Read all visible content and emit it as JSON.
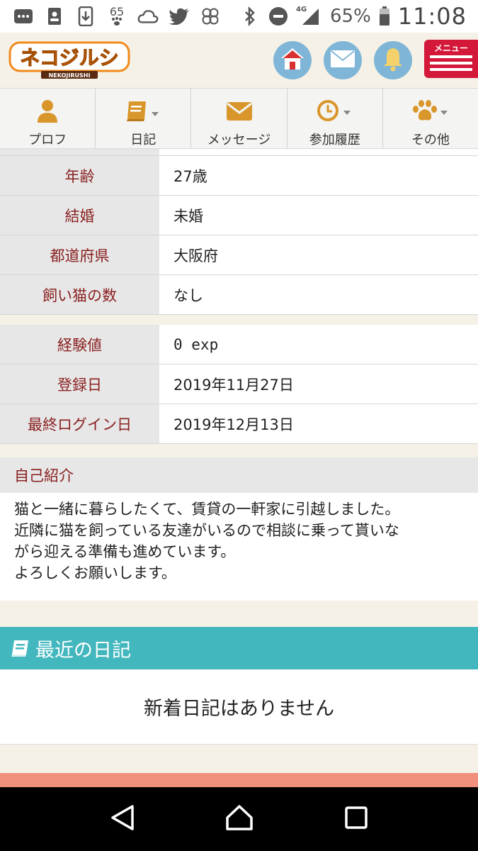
{
  "statusbar": {
    "notif_count": "65",
    "network": "4G",
    "battery": "65%",
    "time": "11:08"
  },
  "header": {
    "logo_text": "ネコジルシ",
    "logo_sub": "NEKOJIRUSHI",
    "menu_label": "メニュー"
  },
  "nav": [
    {
      "label": "プロフ",
      "icon": "person-icon"
    },
    {
      "label": "日記",
      "icon": "book-icon"
    },
    {
      "label": "メッセージ",
      "icon": "envelope-icon"
    },
    {
      "label": "参加履歴",
      "icon": "clock-icon"
    },
    {
      "label": "その他",
      "icon": "paw-icon"
    }
  ],
  "profile_group1": [
    {
      "key": "年齢",
      "value": "27歳"
    },
    {
      "key": "結婚",
      "value": "未婚"
    },
    {
      "key": "都道府県",
      "value": "大阪府"
    },
    {
      "key": "飼い猫の数",
      "value": "なし"
    }
  ],
  "profile_group2": [
    {
      "key": "経験値",
      "value": "0 exp"
    },
    {
      "key": "登録日",
      "value": "2019年11月27日"
    },
    {
      "key": "最終ログイン日",
      "value": "2019年12月13日"
    }
  ],
  "intro": {
    "title": "自己紹介",
    "body": "猫と一緒に暮らしたくて、賃貸の一軒家に引越しました。\n近隣に猫を飼っている友達がいるので相談に乗って貰いな\nがら迎える準備も進めています。\nよろしくお願いします。"
  },
  "diary": {
    "title": "最近の日記",
    "empty": "新着日記はありません"
  },
  "colors": {
    "accent_red": "#d4183a",
    "teal": "#42b7be",
    "key_text": "#8a2020",
    "nav_icon": "#d9962b",
    "logo_orange": "#f08a1c"
  }
}
